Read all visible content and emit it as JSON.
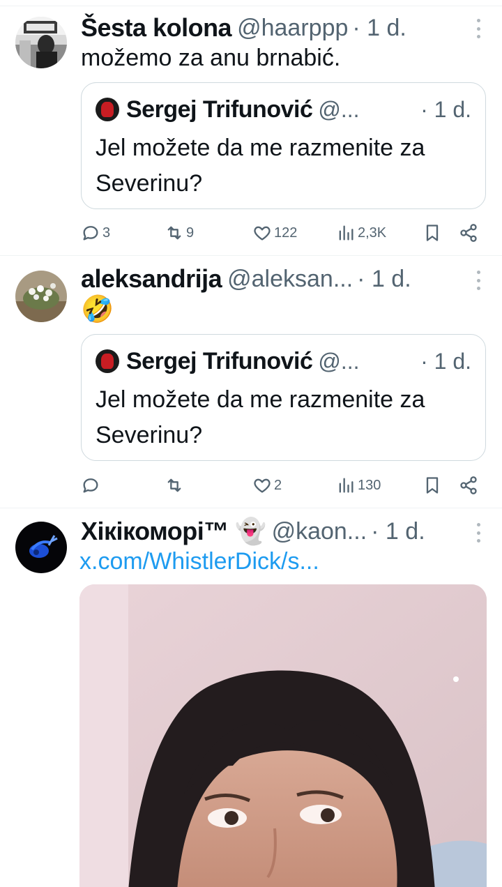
{
  "tweets": [
    {
      "name": "Šesta kolona",
      "handle": "@haarppp",
      "time": "· 1 d.",
      "text": "možemo za anu brnabić.",
      "quote": {
        "name": "Sergej Trifunović",
        "handle": "@...",
        "time": "· 1 d.",
        "text": "Jel možete da me razmenite za Severinu?"
      },
      "stats": {
        "replies": "3",
        "retweets": "9",
        "likes": "122",
        "views": "2,3K"
      }
    },
    {
      "name": "aleksandrija",
      "handle": "@aleksan...",
      "time": "· 1 d.",
      "text": "🤣",
      "quote": {
        "name": "Sergej Trifunović",
        "handle": "@...",
        "time": "· 1 d.",
        "text": "Jel možete da me razmenite za Severinu?"
      },
      "stats": {
        "replies": "",
        "retweets": "",
        "likes": "2",
        "views": "130"
      }
    },
    {
      "name": "Хікікоморі™ 👻",
      "handle": "@kaon...",
      "time": "· 1 d.",
      "link": "x.com/WhistlerDick/s..."
    }
  ],
  "icons": {
    "reply": "reply-icon",
    "retweet": "retweet-icon",
    "like": "heart-icon",
    "views": "views-icon",
    "bookmark": "bookmark-icon",
    "share": "share-icon",
    "more": "more-icon"
  },
  "colors": {
    "link": "#1d9bf0",
    "secondary_text": "#536471",
    "border": "#cfd9de"
  }
}
